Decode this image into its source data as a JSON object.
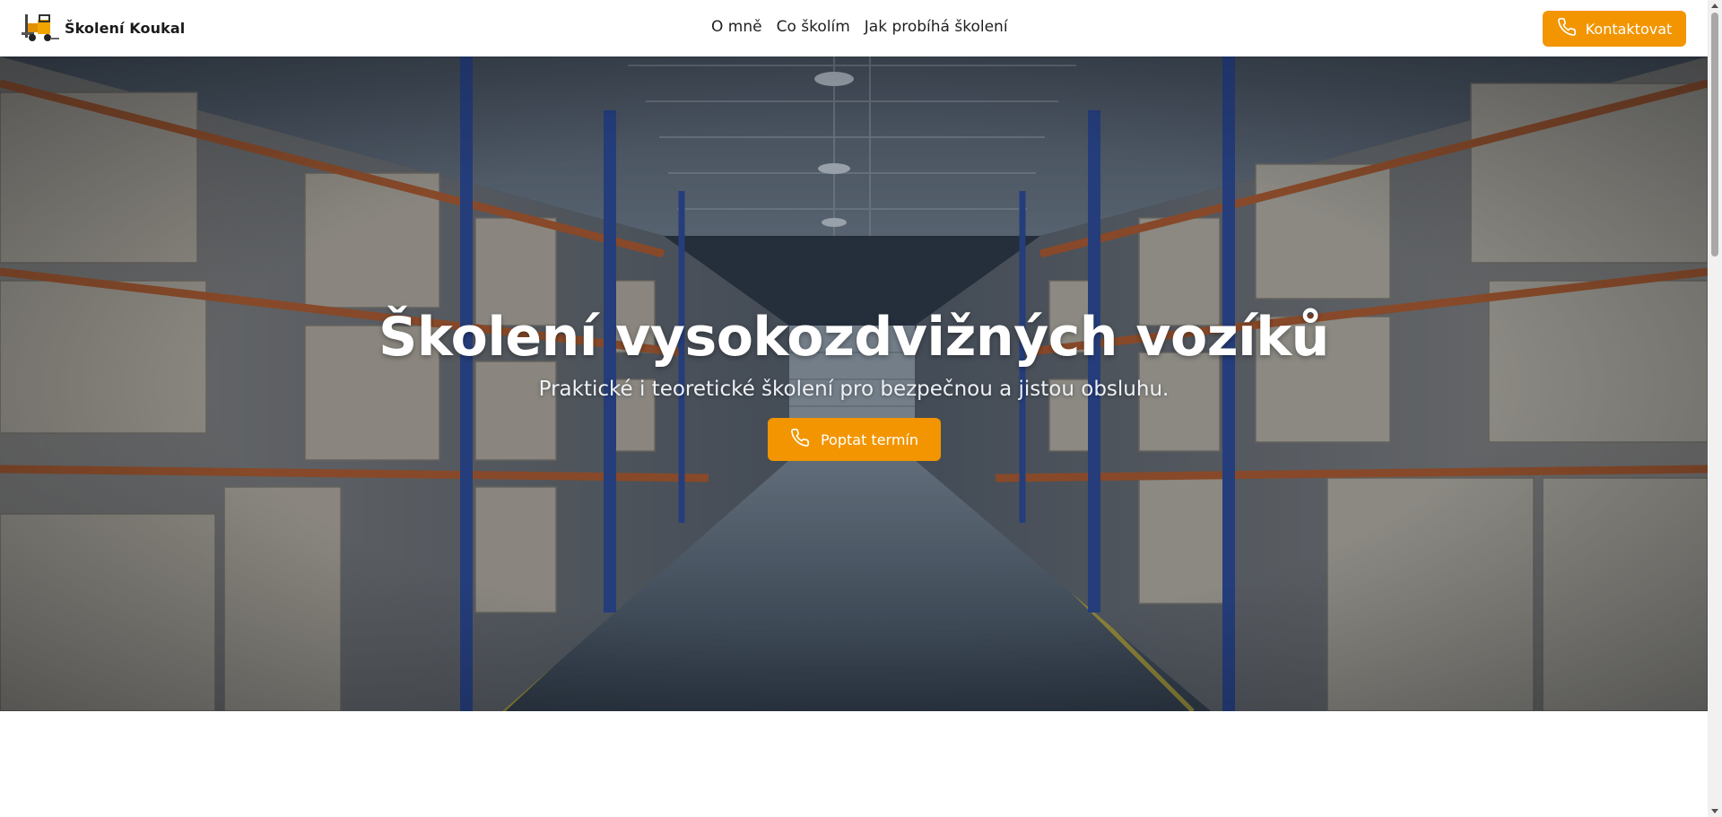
{
  "header": {
    "brand_name": "Školení Koukal",
    "brand_logo_icon": "forklift-icon",
    "nav": [
      {
        "label": "O mně"
      },
      {
        "label": "Co školím"
      },
      {
        "label": "Jak probíhá školení"
      }
    ],
    "contact_button": {
      "label": "Kontaktovat",
      "icon": "phone-icon"
    }
  },
  "hero": {
    "title": "Školení vysokozdvižných vozíků",
    "subtitle": "Praktické i teoretické školení pro bezpečnou a jistou obsluhu.",
    "cta_button": {
      "label": "Poptat termín",
      "icon": "phone-icon"
    },
    "background": "warehouse-aisle-image"
  },
  "colors": {
    "accent": "#f29500",
    "header_bg": "#ffffff",
    "hero_text": "#ffffff"
  }
}
